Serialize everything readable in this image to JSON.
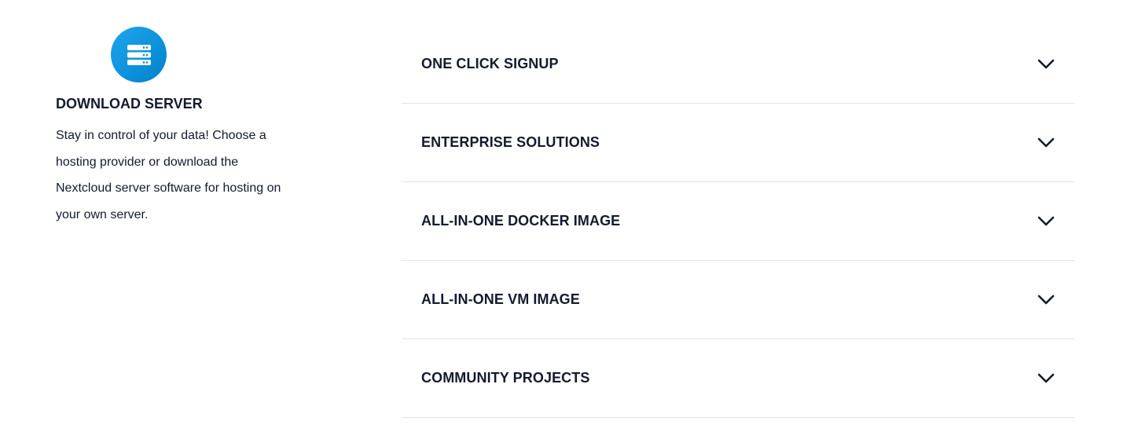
{
  "colors": {
    "icon_background": "#0082c9",
    "text": "#141a2e",
    "divider": "#e3e3e3"
  },
  "download_server": {
    "icon": "server-icon",
    "title": "DOWNLOAD SERVER",
    "description": "Stay in control of your data! Choose a hosting provider or download the Nextcloud server software for hosting on your own server."
  },
  "accordion": {
    "items": [
      {
        "label": "ONE CLICK SIGNUP",
        "icon": "chevron-down-icon"
      },
      {
        "label": "ENTERPRISE SOLUTIONS",
        "icon": "chevron-down-icon"
      },
      {
        "label": "ALL-IN-ONE DOCKER IMAGE",
        "icon": "chevron-down-icon"
      },
      {
        "label": "ALL-IN-ONE VM IMAGE",
        "icon": "chevron-down-icon"
      },
      {
        "label": "COMMUNITY PROJECTS",
        "icon": "chevron-down-icon"
      }
    ]
  }
}
